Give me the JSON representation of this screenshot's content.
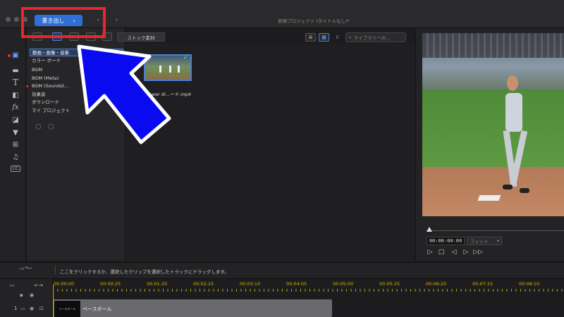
{
  "window": {
    "title": "新規プロジェクト (タイトルなし)*",
    "export_label": "書き出し",
    "export_chevron": "›",
    "back_arrow": "‹",
    "forward_arrow": "›"
  },
  "media_toolbar": {
    "stock_label": "ストック素材",
    "search_placeholder": "ライブラリーの…"
  },
  "categories": [
    {
      "label": "動画・画像・音楽",
      "selected": true
    },
    {
      "label": "カラー ボード",
      "selected": false
    },
    {
      "label": "BGM",
      "selected": false
    },
    {
      "label": "BGM (Meta)",
      "selected": false
    },
    {
      "label": "BGM (Soundst…",
      "selected": false,
      "dot": true
    },
    {
      "label": "効果音",
      "selected": false
    },
    {
      "label": "ダウンロード",
      "selected": false
    },
    {
      "label": "マイ プロジェクト",
      "selected": false
    }
  ],
  "media": {
    "clip_name": "Power di…ード.mp4"
  },
  "preview": {
    "timecode": "00:00:00:00",
    "fit_label": "フィット"
  },
  "timeline": {
    "hint": "ここをクリックするか、選択したクリップを選択したトラックにドラッグします。",
    "ticks": [
      "00:00:00",
      "00:00:25",
      "00:01:20",
      "00:02:15",
      "00:03:10",
      "00:04:05",
      "00:05:00",
      "00:05:25",
      "00:06:20",
      "00:07:15",
      "00:08:10"
    ],
    "track_number": "1",
    "track_clip_label": "ベースボール",
    "track_thumb_label": "ベースボール"
  },
  "colors": {
    "accent": "#2f6fd6",
    "highlight_box": "#e8262b",
    "arrow": "#0a0af0",
    "timeline_ticks": "#d9b400"
  }
}
